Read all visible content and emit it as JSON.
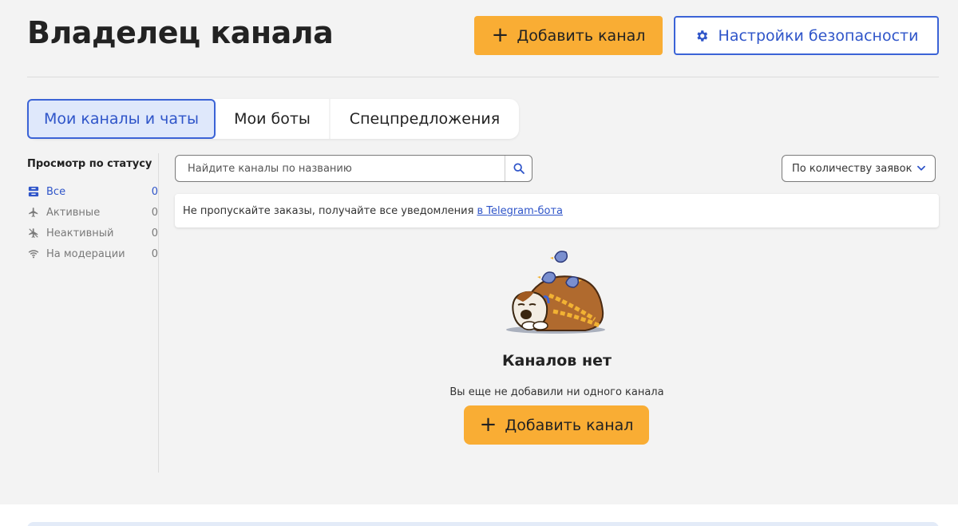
{
  "header": {
    "title": "Владелец канала",
    "add_channel_label": "Добавить канал",
    "security_label": "Настройки безопасности"
  },
  "tabs": [
    {
      "label": "Мои каналы и чаты",
      "active": true
    },
    {
      "label": "Мои боты",
      "active": false
    },
    {
      "label": "Спецпредложения",
      "active": false
    }
  ],
  "sidebar": {
    "title": "Просмотр по статусу",
    "items": [
      {
        "label": "Все",
        "count": "0",
        "icon": "inbox-icon",
        "active": true
      },
      {
        "label": "Активные",
        "count": "0",
        "icon": "airplane-icon",
        "active": false
      },
      {
        "label": "Неактивный",
        "count": "0",
        "icon": "airplane-off-icon",
        "active": false
      },
      {
        "label": "На модерации",
        "count": "0",
        "icon": "wifi-icon",
        "active": false
      }
    ]
  },
  "search": {
    "placeholder": "Найдите каналы по названию",
    "value": ""
  },
  "sort": {
    "selected": "По количеству заявок"
  },
  "notice": {
    "text": "Не пропускайте заказы, получайте все уведомления",
    "link_text": "в Telegram-бота"
  },
  "empty_state": {
    "title": "Каналов нет",
    "description": "Вы еще не добавили ни одного канала",
    "button_label": "Добавить канал"
  },
  "colors": {
    "accent": "#f9ad34",
    "primary": "#3b63d6",
    "background": "#f3f3f3"
  }
}
